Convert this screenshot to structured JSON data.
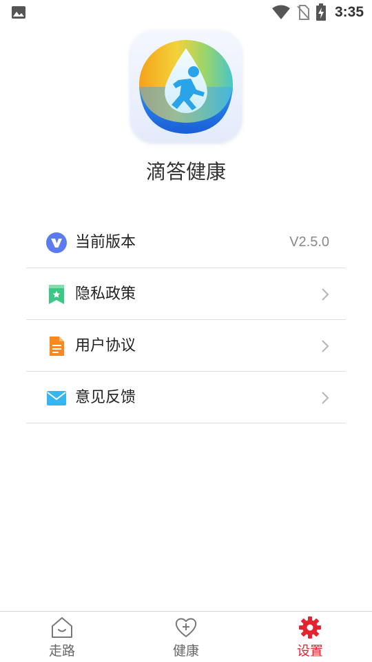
{
  "status_bar": {
    "time": "3:35",
    "icons": [
      "gallery-icon",
      "wifi-icon",
      "no-sim-icon",
      "battery-charging-icon"
    ]
  },
  "app": {
    "name": "滴答健康",
    "icon": "running-droplet-logo"
  },
  "settings": {
    "items": [
      {
        "label": "当前版本",
        "value": "V2.5.0",
        "icon": "version-v-icon",
        "icon_color": "#5a7cf0"
      },
      {
        "label": "隐私政策",
        "icon": "bookmark-star-icon",
        "icon_color": "#3cc785"
      },
      {
        "label": "用户协议",
        "icon": "document-icon",
        "icon_color": "#f7891f"
      },
      {
        "label": "意见反馈",
        "icon": "mail-icon",
        "icon_color": "#36b6f0"
      }
    ]
  },
  "bottom_nav": {
    "items": [
      {
        "label": "走路",
        "icon": "home-icon",
        "active": false
      },
      {
        "label": "健康",
        "icon": "heart-plus-icon",
        "active": false
      },
      {
        "label": "设置",
        "icon": "gear-icon",
        "active": true
      }
    ],
    "active_color": "#e3242e",
    "inactive_color": "#666666"
  }
}
